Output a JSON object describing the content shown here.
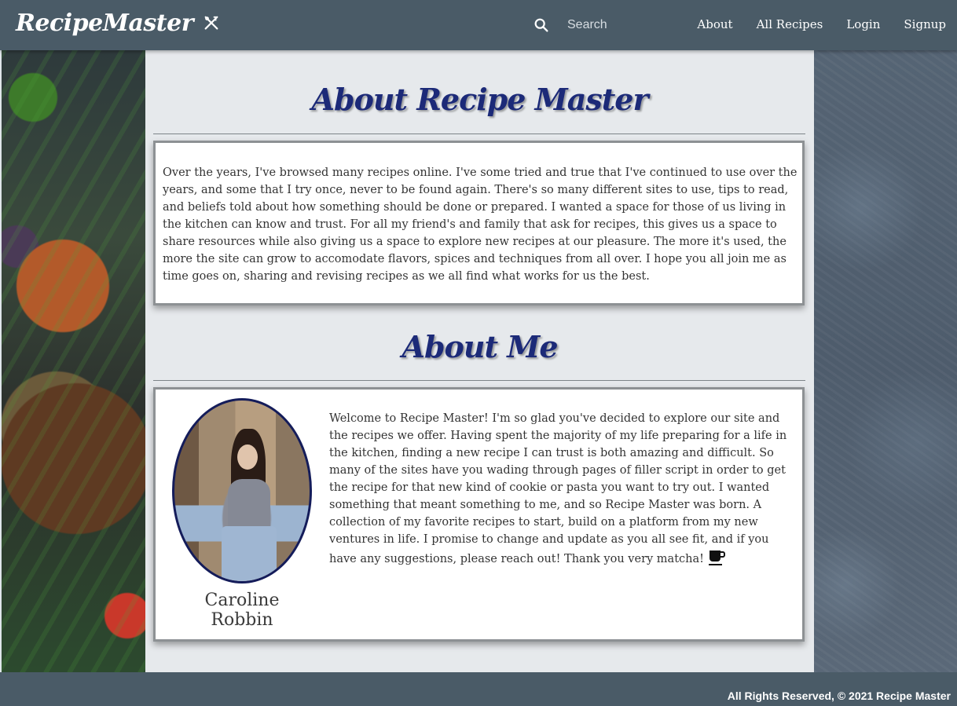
{
  "navbar": {
    "brand": "RecipeMaster",
    "brand_icon": "utensils-crossed-icon",
    "search_icon": "search-icon",
    "search_placeholder": "Search",
    "links": [
      "About",
      "All Recipes",
      "Login",
      "Signup"
    ]
  },
  "about_site": {
    "title": "About Recipe Master",
    "body": "Over the years, I've browsed many recipes online. I've some tried and true that I've continued to use over the years, and some that I try once, never to be found again. There's so many different sites to use, tips to read, and beliefs told about how something should be done or prepared. I wanted a space for those of us living in the kitchen can know and trust. For all my friend's and family that ask for recipes, this gives us a space to share resources while also giving us a space to explore new recipes at our pleasure. The more it's used, the more the site can grow to accomodate flavors, spices and techniques from all over. I hope you all join me as time goes on, sharing and revising recipes as we all find what works for us the best."
  },
  "about_me": {
    "title": "About Me",
    "name": "Caroline Robbin",
    "body": "Welcome to Recipe Master! I'm so glad you've decided to explore our site and the recipes we offer. Having spent the majority of my life preparing for a life in the kitchen, finding a new recipe I can trust is both amazing and difficult. So many of the sites have you wading through pages of filler script in order to get the recipe for that new kind of cookie or pasta you want to try out. I wanted something that meant something to me, and so Recipe Master was born. A collection of my favorite recipes to start, build on a platform from my new ventures in life. I promise to change and update as you all see fit, and if you have any suggestions, please reach out! Thank you very matcha!",
    "end_icon": "coffee-cup-icon"
  },
  "footer": {
    "text": "All Rights Reserved, © 2021 Recipe Master"
  },
  "colors": {
    "navbar": "#4a5b67",
    "title": "#1c2a78",
    "portrait_border": "#141c5a"
  }
}
